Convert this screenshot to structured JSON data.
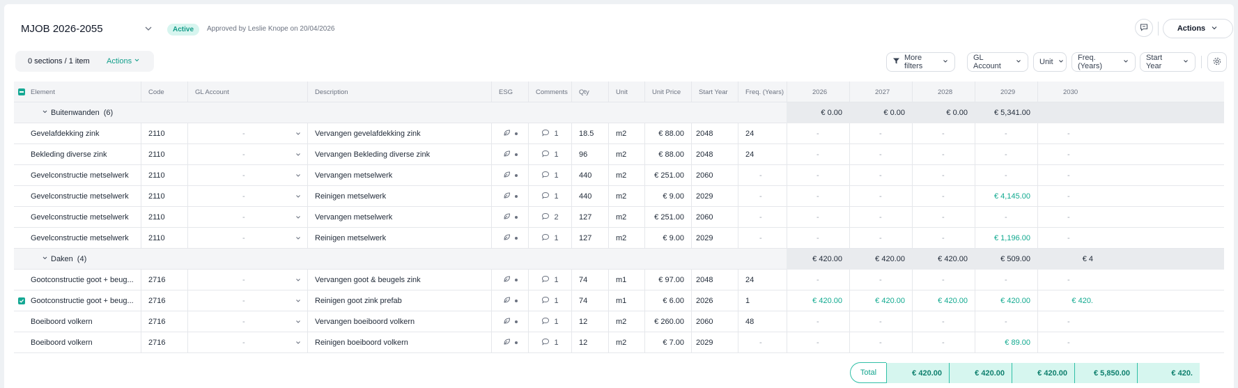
{
  "header": {
    "title": "MJOB 2026-2055",
    "status": "Active",
    "approval": "Approved by Leslie Knope on 20/04/2026",
    "actions_label": "Actions"
  },
  "toolbar": {
    "selection": "0 sections / 1 item",
    "actions_label": "Actions",
    "filters": [
      "More filters",
      "GL Account",
      "Unit",
      "Freq. (Years)",
      "Start Year"
    ]
  },
  "columns": [
    "Element",
    "Code",
    "GL Account",
    "Description",
    "ESG",
    "Comments",
    "Qty",
    "Unit",
    "Unit Price",
    "Start Year",
    "Freq. (Years)"
  ],
  "years": [
    "2026",
    "2027",
    "2028",
    "2029",
    "2030"
  ],
  "dash": "-",
  "groups": [
    {
      "name": "Buitenwanden",
      "count": "(6)",
      "totals": [
        "€ 0.00",
        "€ 0.00",
        "€ 0.00",
        "€ 5,341.00",
        ""
      ],
      "rows": [
        {
          "element": "Gevelafdekking zink",
          "code": "2110",
          "gl": "-",
          "description": "Vervangen gevelafdekking zink",
          "comments": "1",
          "qty": "18.5",
          "unit": "m2",
          "price": "€ 88.00",
          "start": "2048",
          "freq": "24",
          "years": [
            "-",
            "-",
            "-",
            "-",
            "-"
          ],
          "checked": false
        },
        {
          "element": "Bekleding diverse zink",
          "code": "2110",
          "gl": "-",
          "description": "Vervangen Bekleding diverse zink",
          "comments": "1",
          "qty": "96",
          "unit": "m2",
          "price": "€ 88.00",
          "start": "2048",
          "freq": "24",
          "years": [
            "-",
            "-",
            "-",
            "-",
            "-"
          ],
          "checked": false
        },
        {
          "element": "Gevelconstructie metselwerk",
          "code": "2110",
          "gl": "-",
          "description": "Vervangen metselwerk",
          "comments": "1",
          "qty": "440",
          "unit": "m2",
          "price": "€ 251.00",
          "start": "2060",
          "freq": "-",
          "years": [
            "-",
            "-",
            "-",
            "-",
            "-"
          ],
          "checked": false
        },
        {
          "element": "Gevelconstructie metselwerk",
          "code": "2110",
          "gl": "-",
          "description": "Reinigen metselwerk",
          "comments": "1",
          "qty": "440",
          "unit": "m2",
          "price": "€ 9.00",
          "start": "2029",
          "freq": "-",
          "years": [
            "-",
            "-",
            "-",
            "€ 4,145.00",
            "-"
          ],
          "checked": false
        },
        {
          "element": "Gevelconstructie metselwerk",
          "code": "2110",
          "gl": "-",
          "description": "Vervangen metselwerk",
          "comments": "2",
          "qty": "127",
          "unit": "m2",
          "price": "€ 251.00",
          "start": "2060",
          "freq": "-",
          "years": [
            "-",
            "-",
            "-",
            "-",
            "-"
          ],
          "checked": false
        },
        {
          "element": "Gevelconstructie metselwerk",
          "code": "2110",
          "gl": "-",
          "description": "Reinigen metselwerk",
          "comments": "1",
          "qty": "127",
          "unit": "m2",
          "price": "€ 9.00",
          "start": "2029",
          "freq": "-",
          "years": [
            "-",
            "-",
            "-",
            "€ 1,196.00",
            "-"
          ],
          "checked": false
        }
      ]
    },
    {
      "name": "Daken",
      "count": "(4)",
      "totals": [
        "€ 420.00",
        "€ 420.00",
        "€ 420.00",
        "€ 509.00",
        "€ 4"
      ],
      "rows": [
        {
          "element": "Gootconstructie goot + beug...",
          "code": "2716",
          "gl": "-",
          "description": "Vervangen goot & beugels zink",
          "comments": "1",
          "qty": "74",
          "unit": "m1",
          "price": "€ 97.00",
          "start": "2048",
          "freq": "24",
          "years": [
            "-",
            "-",
            "-",
            "-",
            "-"
          ],
          "checked": false
        },
        {
          "element": "Gootconstructie goot + beug...",
          "code": "2716",
          "gl": "-",
          "description": "Reinigen goot zink prefab",
          "comments": "1",
          "qty": "74",
          "unit": "m1",
          "price": "€ 6.00",
          "start": "2026",
          "freq": "1",
          "years": [
            "€ 420.00",
            "€ 420.00",
            "€ 420.00",
            "€ 420.00",
            "€ 420."
          ],
          "checked": true
        },
        {
          "element": "Boeiboord volkern",
          "code": "2716",
          "gl": "-",
          "description": "Vervangen boeiboord volkern",
          "comments": "1",
          "qty": "12",
          "unit": "m2",
          "price": "€ 260.00",
          "start": "2060",
          "freq": "48",
          "years": [
            "-",
            "-",
            "-",
            "-",
            "-"
          ],
          "checked": false
        },
        {
          "element": "Boeiboord volkern",
          "code": "2716",
          "gl": "-",
          "description": "Reinigen boeiboord volkern",
          "comments": "1",
          "qty": "12",
          "unit": "m2",
          "price": "€ 7.00",
          "start": "2029",
          "freq": "-",
          "years": [
            "-",
            "-",
            "-",
            "€ 89.00",
            "-"
          ],
          "checked": false
        }
      ]
    }
  ],
  "footer": {
    "label": "Total",
    "values": [
      "€ 420.00",
      "€ 420.00",
      "€ 420.00",
      "€ 5,850.00",
      "€ 420."
    ]
  },
  "colors": {
    "accent": "#15a894",
    "accent_text": "#10a98f",
    "total_bg": "#d6f6ef"
  }
}
